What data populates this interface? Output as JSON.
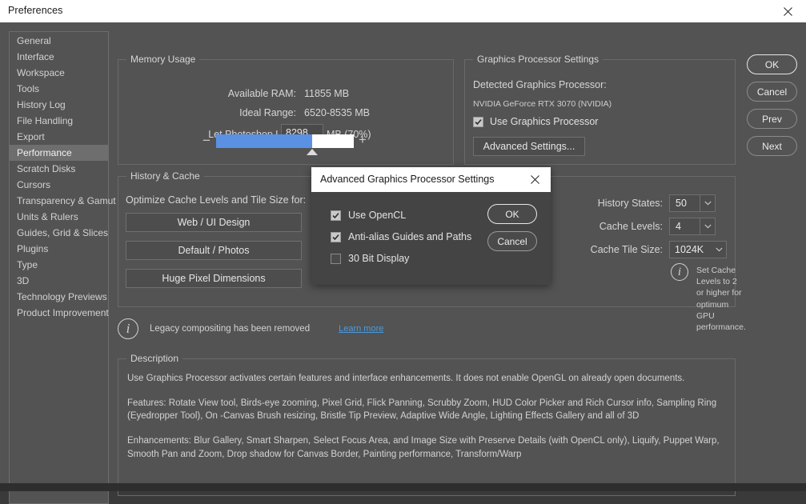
{
  "window": {
    "title": "Preferences",
    "close_icon": "close-icon"
  },
  "sidebar": {
    "items": [
      {
        "label": "General",
        "selected": false
      },
      {
        "label": "Interface",
        "selected": false
      },
      {
        "label": "Workspace",
        "selected": false
      },
      {
        "label": "Tools",
        "selected": false
      },
      {
        "label": "History Log",
        "selected": false
      },
      {
        "label": "File Handling",
        "selected": false
      },
      {
        "label": "Export",
        "selected": false
      },
      {
        "label": "Performance",
        "selected": true
      },
      {
        "label": "Scratch Disks",
        "selected": false
      },
      {
        "label": "Cursors",
        "selected": false
      },
      {
        "label": "Transparency & Gamut",
        "selected": false
      },
      {
        "label": "Units & Rulers",
        "selected": false
      },
      {
        "label": "Guides, Grid & Slices",
        "selected": false
      },
      {
        "label": "Plugins",
        "selected": false
      },
      {
        "label": "Type",
        "selected": false
      },
      {
        "label": "3D",
        "selected": false
      },
      {
        "label": "Technology Previews",
        "selected": false
      },
      {
        "label": "Product Improvement",
        "selected": false
      }
    ]
  },
  "memory_usage": {
    "group_title": "Memory Usage",
    "available_ram_label": "Available RAM:",
    "available_ram_value": "11855 MB",
    "ideal_range_label": "Ideal Range:",
    "ideal_range_value": "6520-8535 MB",
    "let_photoshop_use_label": "Let Photoshop Use:",
    "let_photoshop_use_value": "8298",
    "unit_text": "MB (70%)",
    "slider_percent": 70,
    "minus_label": "−",
    "plus_label": "+",
    "fill_color": "#5b91e3",
    "track_color": "#ffffff"
  },
  "graphics_processor": {
    "group_title": "Graphics Processor Settings",
    "detected_label": "Detected Graphics Processor:",
    "detected_value": "NVIDIA GeForce RTX 3070 (NVIDIA)",
    "use_gpu_label": "Use Graphics Processor",
    "use_gpu_checked": true,
    "advanced_settings_label": "Advanced Settings..."
  },
  "history_cache": {
    "group_title": "History & Cache",
    "optimize_label": "Optimize Cache Levels and Tile Size for:",
    "presets": [
      {
        "label": "Web / UI Design"
      },
      {
        "label": "Default / Photos"
      },
      {
        "label": "Huge Pixel Dimensions"
      }
    ],
    "history_states_label": "History States:",
    "history_states_value": "50",
    "cache_levels_label": "Cache Levels:",
    "cache_levels_value": "4",
    "cache_tile_size_label": "Cache Tile Size:",
    "cache_tile_size_value": "1024K",
    "note_text": "Set Cache Levels to 2 or higher for\noptimum GPU performance.",
    "note_icon": "info-icon",
    "chevron": "⌄"
  },
  "legacy_notice": {
    "icon": "info-icon",
    "text": "Legacy compositing has been removed",
    "link_label": "Learn more",
    "link_color": "#4c9bdd"
  },
  "description": {
    "group_title": "Description",
    "paragraphs": [
      "Use Graphics Processor activates certain features and interface enhancements. It does not enable OpenGL on already open documents.",
      "Features: Rotate View tool, Birds-eye zooming, Pixel Grid, Flick Panning, Scrubby Zoom, HUD Color Picker and Rich Cursor info, Sampling Ring (Eyedropper Tool), On -Canvas Brush resizing, Bristle Tip Preview, Adaptive Wide Angle, Lighting Effects Gallery and all of 3D",
      "Enhancements: Blur Gallery, Smart Sharpen, Select Focus Area, and Image Size with Preserve Details (with OpenCL only), Liquify, Puppet Warp, Smooth Pan and Zoom, Drop shadow for Canvas Border, Painting performance, Transform/Warp"
    ]
  },
  "actions": {
    "ok": "OK",
    "cancel": "Cancel",
    "prev": "Prev",
    "next": "Next"
  },
  "modal": {
    "title": "Advanced Graphics Processor Settings",
    "close_icon": "close-icon",
    "checkboxes": [
      {
        "label": "Use OpenCL",
        "checked": true
      },
      {
        "label": "Anti-alias Guides and Paths",
        "checked": true
      },
      {
        "label": "30 Bit Display",
        "checked": false
      }
    ],
    "ok": "OK",
    "cancel": "Cancel"
  }
}
